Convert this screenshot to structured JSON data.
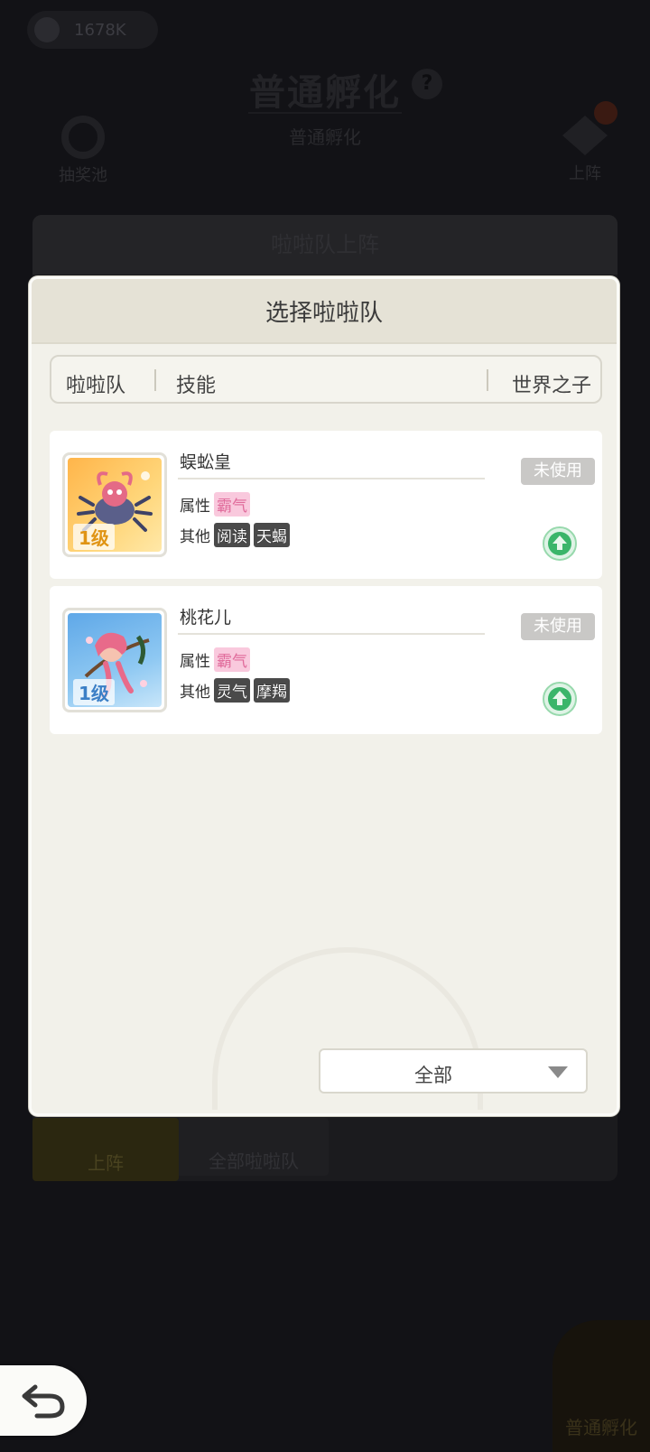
{
  "background": {
    "currency_value": "1678K",
    "title": "普通孵化",
    "subtitle": "普通孵化",
    "left_button_label": "抽奖池",
    "right_button_label": "上阵",
    "panel_title": "啦啦队上阵",
    "tab_active_label": "上阵",
    "tab_inactive_label": "全部啦啦队",
    "egg_label": "普通孵化"
  },
  "modal": {
    "title": "选择啦啦队",
    "columns": [
      "啦啦队",
      "技能",
      "世界之子"
    ],
    "cards": [
      {
        "level": "1级",
        "name": "蜈蚣皇",
        "attr_label": "属性",
        "attr_tag": "霸气",
        "other_label": "其他",
        "other_tags": [
          "阅读",
          "天蝎"
        ],
        "status": "未使用"
      },
      {
        "level": "1级",
        "name": "桃花儿",
        "attr_label": "属性",
        "attr_tag": "霸气",
        "other_label": "其他",
        "other_tags": [
          "灵气",
          "摩羯"
        ],
        "status": "未使用"
      }
    ],
    "filter_value": "全部"
  },
  "colors": {
    "status_bg": "#c9c8c6",
    "attr_tag_bg": "#f9c9dd",
    "level_gold": "#e09414",
    "level_blue": "#3b7fc6",
    "upgrade_green": "#3bb56a"
  }
}
